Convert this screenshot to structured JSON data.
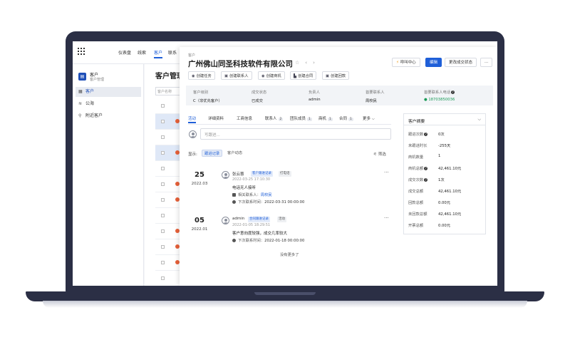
{
  "topnav": {
    "items": [
      "仪表盘",
      "线索",
      "客户",
      "联系"
    ],
    "active_index": 2
  },
  "sidebar": {
    "title": "客户",
    "subtitle": "客户管理",
    "items": [
      {
        "label": "客户",
        "icon": "list-icon",
        "active": true
      },
      {
        "label": "公海",
        "icon": "sea-icon",
        "active": false
      },
      {
        "label": "附近客户",
        "icon": "location-pin-icon",
        "active": false
      }
    ]
  },
  "bgpage": {
    "title": "客户管理",
    "search_placeholder": "客户名称"
  },
  "detail": {
    "breadcrumb": "客户",
    "company": "广州佛山同圣科技软件有限公司",
    "header_buttons": {
      "call_center": "呼叫中心",
      "edit": "编辑",
      "change_status": "更改成交状态",
      "more": "···"
    },
    "actions": [
      "创建任务",
      "创建联系人",
      "创建商机",
      "创建合同",
      "创建回款"
    ],
    "info": [
      {
        "label": "客户级别",
        "value": "C（非优先客户）"
      },
      {
        "label": "成交状态",
        "value": "已成交"
      },
      {
        "label": "负责人",
        "value": "admin"
      },
      {
        "label": "首要联系人",
        "value": "周校民"
      },
      {
        "label": "首要联系人电话",
        "value": "18703850036"
      }
    ],
    "tabs": [
      {
        "label": "活动",
        "count": ""
      },
      {
        "label": "详细资料",
        "count": ""
      },
      {
        "label": "工商信息",
        "count": ""
      },
      {
        "label": "联系人",
        "count": "2"
      },
      {
        "label": "团队成员",
        "count": "1"
      },
      {
        "label": "商机",
        "count": "1"
      },
      {
        "label": "合同",
        "count": "1"
      },
      {
        "label": "更多 ⌵",
        "count": ""
      }
    ],
    "write_placeholder": "写跟进...",
    "filter": {
      "label": "显示:",
      "chips": [
        "跟进记录",
        "客户动态"
      ],
      "filter_btn": "筛选"
    },
    "entries": [
      {
        "day": "25",
        "ym": "2022.03",
        "name": "张云蓉",
        "tags": [
          "客户跟进记录",
          "打电话"
        ],
        "time": "2022-03-25 17:10:30",
        "text": "电话无人接听",
        "contact_label": "相关联系人：",
        "contact": "周校民",
        "next_label": "下次联系时间：",
        "next": "2022-03-31 00:00:00"
      },
      {
        "day": "05",
        "ym": "2022.01",
        "name": "admin",
        "tags": [
          "合同跟进记录",
          "活动"
        ],
        "time": "2022-01-05 18:29:51",
        "text": "客户意向度较强，成交几率较大",
        "next_label": "下次联系时间：",
        "next": "2022-01-18 00:00:00"
      }
    ],
    "no_more": "没有更多了",
    "summary": {
      "title": "客户摘要",
      "rows": [
        {
          "label": "跟进次数",
          "value": "0次",
          "help": true
        },
        {
          "label": "未跟进时长",
          "value": "-255天",
          "help": false
        },
        {
          "label": "商机数量",
          "value": "1",
          "help": false
        },
        {
          "label": "商机总额",
          "value": "42,461.10元",
          "help": true
        },
        {
          "label": "成交次数",
          "value": "1次",
          "help": true
        },
        {
          "label": "成交总额",
          "value": "42,461.10元",
          "help": false
        },
        {
          "label": "回款总额",
          "value": "0.00元",
          "help": false
        },
        {
          "label": "未回款总额",
          "value": "42,461.10元",
          "help": false
        },
        {
          "label": "开票总额",
          "value": "0.00元",
          "help": false
        }
      ]
    }
  },
  "colors": {
    "primary": "#1f5fd8",
    "laptop": "#2b2f45",
    "phone_green": "#1a9a57"
  }
}
